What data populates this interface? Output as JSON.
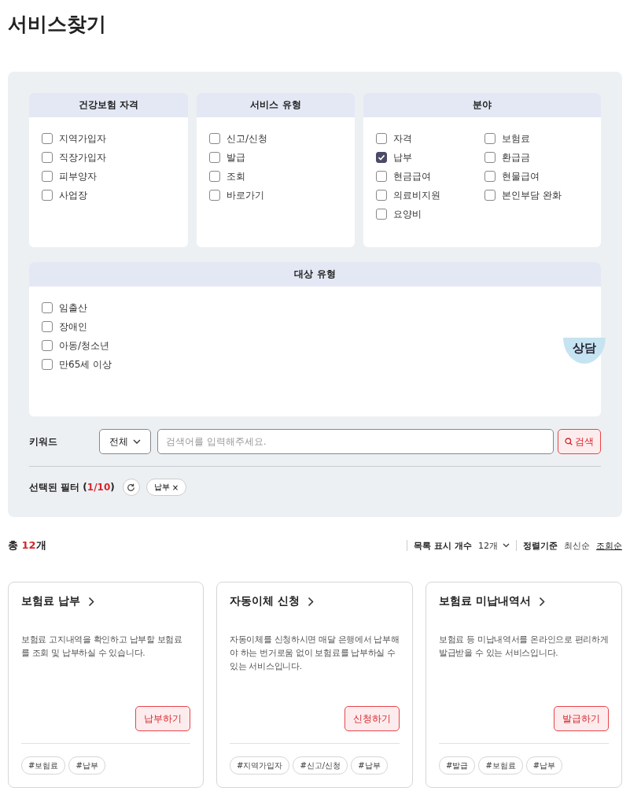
{
  "page_title": "서비스찾기",
  "filter_groups": [
    {
      "title": "건강보험 자격",
      "kind": "single-column",
      "options": [
        {
          "label": "지역가입자",
          "checked": false
        },
        {
          "label": "직장가입자",
          "checked": false
        },
        {
          "label": "피부양자",
          "checked": false
        },
        {
          "label": "사업장",
          "checked": false
        }
      ]
    },
    {
      "title": "서비스 유형",
      "kind": "single-column",
      "options": [
        {
          "label": "신고/신청",
          "checked": false
        },
        {
          "label": "발급",
          "checked": false
        },
        {
          "label": "조회",
          "checked": false
        },
        {
          "label": "바로가기",
          "checked": false
        }
      ]
    },
    {
      "title": "분야",
      "kind": "two-column",
      "options": [
        {
          "label": "자격",
          "checked": false
        },
        {
          "label": "보험료",
          "checked": false
        },
        {
          "label": "납부",
          "checked": true
        },
        {
          "label": "환급금",
          "checked": false
        },
        {
          "label": "현금급여",
          "checked": false
        },
        {
          "label": "현물급여",
          "checked": false
        },
        {
          "label": "의료비지원",
          "checked": false
        },
        {
          "label": "본인부담 완화",
          "checked": false
        },
        {
          "label": "요양비",
          "checked": false
        }
      ]
    },
    {
      "title": "대상 유형",
      "kind": "single-column",
      "options": [
        {
          "label": "임출산",
          "checked": false
        },
        {
          "label": "장애인",
          "checked": false
        },
        {
          "label": "아동/청소년",
          "checked": false
        },
        {
          "label": "만65세 이상",
          "checked": false
        }
      ]
    }
  ],
  "chat_button": "상담",
  "keyword": {
    "label": "키워드",
    "scope": "전체",
    "placeholder": "검색어를 입력해주세요.",
    "search_button": "검색"
  },
  "selected_filters": {
    "label": "선택된 필터 (",
    "count": "1/10",
    "label_end": ")",
    "chips": [
      {
        "label": "납부",
        "remove": "×"
      }
    ]
  },
  "results": {
    "total_prefix": "총 ",
    "total_count": "12",
    "total_suffix": "개",
    "page_size_label": "목록 표시 개수",
    "page_size": "12개",
    "sort_label": "정렬기준",
    "sort_options": [
      {
        "label": "최신순",
        "selected": false
      },
      {
        "label": "조회순",
        "selected": true
      }
    ]
  },
  "cards": [
    {
      "title": "보험료 납부",
      "description": "보험료 고지내역을 확인하고 납부할 보험료를 조회 및 납부하실 수 있습니다.",
      "action": "납부하기",
      "tags": [
        "#보험료",
        "#납부"
      ]
    },
    {
      "title": "자동이체 신청",
      "description": "자동이체를 신청하시면 매달 은행에서 납부해야 하는 번거로움 없이 보험료를 납부하실 수 있는 서비스입니다.",
      "action": "신청하기",
      "tags": [
        "#지역가입자",
        "#신고/신청",
        "#납부"
      ]
    },
    {
      "title": "보험료 미납내역서",
      "description": "보험료 등 미납내역서를 온라인으로 편리하게 발급받을 수 있는 서비스입니다.",
      "action": "발급하기",
      "tags": [
        "#발급",
        "#보험료",
        "#납부"
      ]
    }
  ]
}
